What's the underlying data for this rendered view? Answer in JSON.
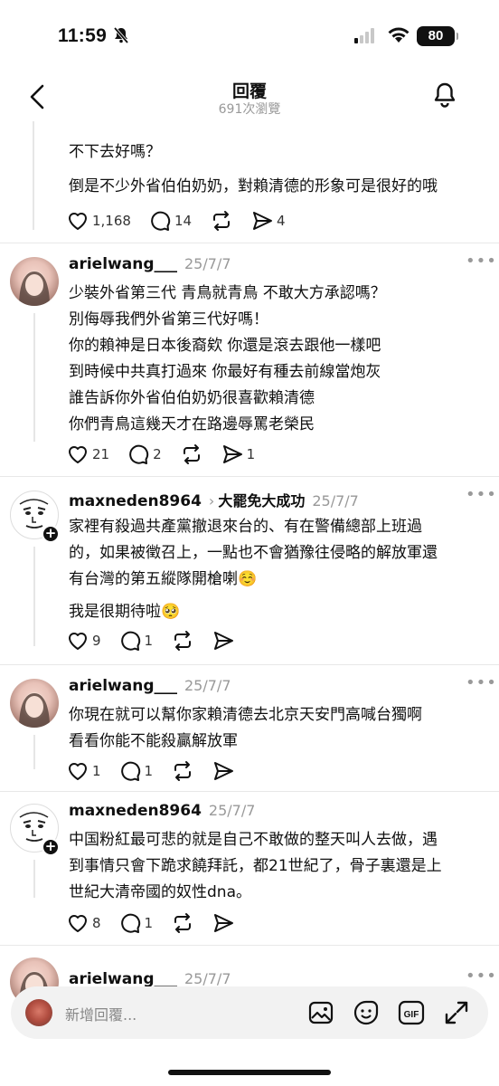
{
  "status": {
    "time": "11:59",
    "battery": "80"
  },
  "header": {
    "title": "回覆",
    "views": "691次瀏覽"
  },
  "prev_post": {
    "partial_line": "不下去好嗎？",
    "line2": "倒是不少外省伯伯奶奶，對賴清德的形象可是很好的哦",
    "likes": "1,168",
    "comments": "14",
    "shares": "4"
  },
  "posts": [
    {
      "username": "arielwang___",
      "date": "25/7/7",
      "lines": [
        "少裝外省第三代 青鳥就青鳥 不敢大方承認嗎？",
        "別侮辱我們外省第三代好嗎！",
        "你的賴神是日本後裔欸 你還是滾去跟他一樣吧",
        "到時候中共真打過來 你最好有種去前線當炮灰",
        "誰告訴你外省伯伯奶奶很喜歡賴清德",
        "你們青鳥這幾天才在路邊辱罵老榮民"
      ],
      "likes": "21",
      "comments": "2",
      "shares": "1"
    },
    {
      "username": "maxneden8964",
      "reply_to": "大罷免大成功",
      "date": "25/7/7",
      "lines": [
        "家裡有殺過共產黨撤退來台的、有在警備總部上班過",
        "的，如果被徵召上，一點也不會猶豫往侵略的解放軍還",
        "有台灣的第五縱隊開槍喇☺️"
      ],
      "extra_line": "我是很期待啦🥺",
      "likes": "9",
      "comments": "1"
    },
    {
      "username": "arielwang___",
      "date": "25/7/7",
      "lines": [
        "你現在就可以幫你家賴清德去北京天安門高喊台獨啊",
        "看看你能不能殺贏解放軍"
      ],
      "likes": "1",
      "comments": "1"
    },
    {
      "username": "maxneden8964",
      "date": "25/7/7",
      "lines": [
        "中国粉紅最可悲的就是自己不敢做的整天叫人去做，遇",
        "到事情只會下跪求饒拜託，都21世紀了，骨子裏還是上",
        "世紀大清帝國的奴性dna。"
      ],
      "likes": "8",
      "comments": "1"
    },
    {
      "username": "arielwang___",
      "date": "25/7/7"
    }
  ],
  "composer": {
    "placeholder": "新增回覆..."
  },
  "icons": [
    "back-icon",
    "bell-icon",
    "heart-icon",
    "comment-icon",
    "repost-icon",
    "share-icon",
    "image-icon",
    "sticker-icon",
    "gif-icon",
    "expand-icon",
    "more-icon"
  ]
}
